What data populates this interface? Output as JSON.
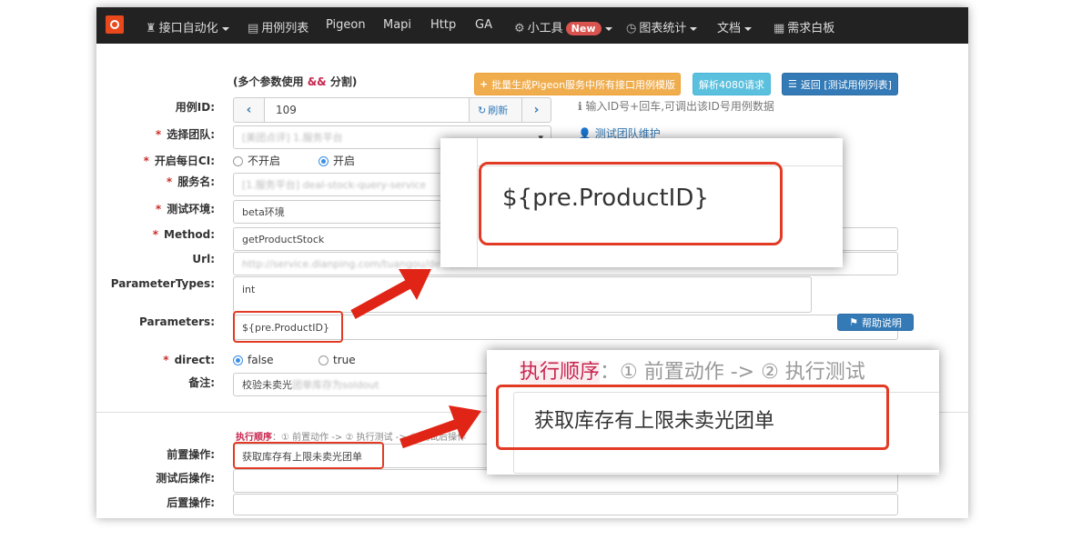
{
  "navbar": {
    "items": [
      {
        "icon": "bank-icon",
        "label": "接口自动化",
        "dropdown": true
      },
      {
        "icon": "list-icon",
        "label": "用例列表",
        "dropdown": false
      },
      {
        "icon": "",
        "label": "Pigeon",
        "dropdown": false
      },
      {
        "icon": "",
        "label": "Mapi",
        "dropdown": false
      },
      {
        "icon": "",
        "label": "Http",
        "dropdown": false
      },
      {
        "icon": "",
        "label": "GA",
        "dropdown": false
      },
      {
        "icon": "gear-icon",
        "label": "小工具",
        "badge": "New",
        "dropdown": true
      },
      {
        "icon": "clock-icon",
        "label": "图表统计",
        "dropdown": true
      },
      {
        "icon": "",
        "label": "文档",
        "dropdown": true
      },
      {
        "icon": "board-icon",
        "label": "需求白板",
        "dropdown": false
      }
    ],
    "colors": {
      "background": "#222222",
      "badge": "#d9534f"
    }
  },
  "top_hint": {
    "prefix": "(多个参数使用",
    "separator": "&&",
    "suffix": "分割)"
  },
  "buttons": {
    "batch_generate": "批量生成Pigeon服务中所有接口用例模版",
    "parse_4080": "解析4080请求",
    "back": "返回 [测试用例列表]",
    "refresh": "刷新",
    "help": "帮助说明",
    "team_maintain": "测试团队维护"
  },
  "form": {
    "case_id": {
      "label": "用例ID:",
      "value": "109",
      "hint": "输入ID号+回车,可调出该ID号用例数据"
    },
    "team": {
      "label": "选择团队:",
      "value": "[美团点评]  1.服务平台"
    },
    "daily_ci": {
      "label": "开启每日CI:",
      "options": [
        "不开启",
        "开启"
      ],
      "selected": "开启"
    },
    "service": {
      "label": "服务名:",
      "value": "[1.服务平台] deal-stock-query-service"
    },
    "env": {
      "label": "测试环境:",
      "value": "beta环境"
    },
    "method": {
      "label": "Method:",
      "value": "getProductStock"
    },
    "url": {
      "label": "Url:",
      "value": "http://service.dianping.com/tuangou/dealStock"
    },
    "parameter_types": {
      "label": "ParameterTypes:",
      "value": "int"
    },
    "parameters": {
      "label": "Parameters:",
      "value": "${pre.ProductID}"
    },
    "direct": {
      "label": "direct:",
      "options": [
        "false",
        "true"
      ],
      "selected": "false"
    },
    "remark": {
      "label": "备注:",
      "value": "校验未卖光",
      "blurred_tail": "团单库存为soldout"
    },
    "exec_order": {
      "title": "执行顺序",
      "text": "：① 前置动作 -> ② 执行测试 -> ③ 测试后操作"
    },
    "pre_action": {
      "label": "前置操作:",
      "value": "获取库存有上限未卖光团单"
    },
    "post_test_action": {
      "label": "测试后操作:",
      "value": ""
    },
    "post_action": {
      "label": "后置操作:",
      "value": ""
    }
  },
  "zoom1": {
    "value": "${pre.ProductID}"
  },
  "zoom2": {
    "title": "执行顺序",
    "text": "：① 前置动作 -> ② 执行测试",
    "value": "获取库存有上限未卖光团单"
  },
  "colors": {
    "primary": "#337ab7",
    "info": "#5bc0de",
    "warning": "#f0ad4e",
    "highlight": "#e23b25"
  }
}
